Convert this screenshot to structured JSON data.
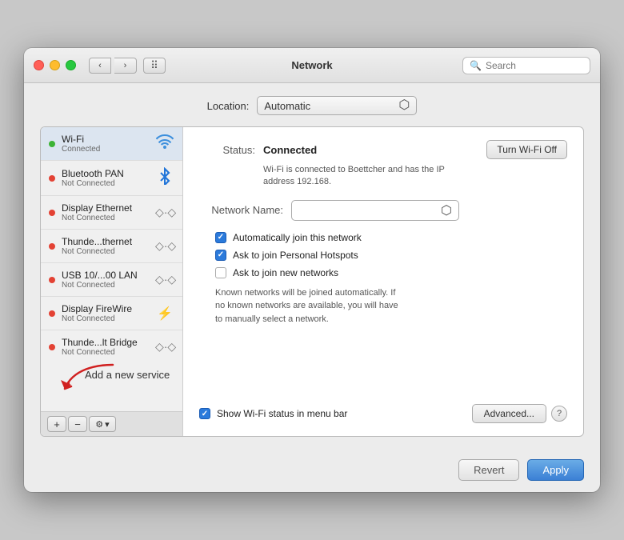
{
  "window": {
    "title": "Network"
  },
  "titlebar": {
    "back_label": "‹",
    "forward_label": "›",
    "grid_label": "⠿",
    "search_placeholder": "Search"
  },
  "location": {
    "label": "Location:",
    "value": "Automatic"
  },
  "sidebar": {
    "items": [
      {
        "name": "Wi-Fi",
        "status": "Connected",
        "dot": "green",
        "icon": "wifi"
      },
      {
        "name": "Bluetooth PAN",
        "status": "Not Connected",
        "dot": "red",
        "icon": "bluetooth"
      },
      {
        "name": "Display Ethernet",
        "status": "Not Connected",
        "dot": "red",
        "icon": "ethernet"
      },
      {
        "name": "Thunde...thernet",
        "status": "Not Connected",
        "dot": "red",
        "icon": "ethernet"
      },
      {
        "name": "USB 10/...00 LAN",
        "status": "Not Connected",
        "dot": "red",
        "icon": "ethernet"
      },
      {
        "name": "Display FireWire",
        "status": "Not Connected",
        "dot": "red",
        "icon": "firewire"
      },
      {
        "name": "Thunde...lt Bridge",
        "status": "Not Connected",
        "dot": "red",
        "icon": "ethernet"
      }
    ],
    "add_label": "+",
    "remove_label": "−",
    "gear_label": "⚙",
    "gear_arrow": "▾"
  },
  "detail": {
    "status_label": "Status:",
    "status_value": "Connected",
    "turn_off_label": "Turn Wi-Fi Off",
    "status_desc": "Wi-Fi is connected to Boettcher and has the IP\naddress 192.168.",
    "network_name_label": "Network Name:",
    "checkboxes": [
      {
        "label": "Automatically join this network",
        "checked": true
      },
      {
        "label": "Ask to join Personal Hotspots",
        "checked": true
      },
      {
        "label": "Ask to join new networks",
        "checked": false
      }
    ],
    "known_networks_note": "Known networks will be joined automatically. If\nno known networks are available, you will have\nto manually select a network.",
    "show_wifi_label": "Show Wi-Fi status in menu bar",
    "advanced_label": "Advanced...",
    "help_label": "?"
  },
  "footer": {
    "revert_label": "Revert",
    "apply_label": "Apply"
  },
  "annotation": {
    "text": "Add a new service"
  }
}
